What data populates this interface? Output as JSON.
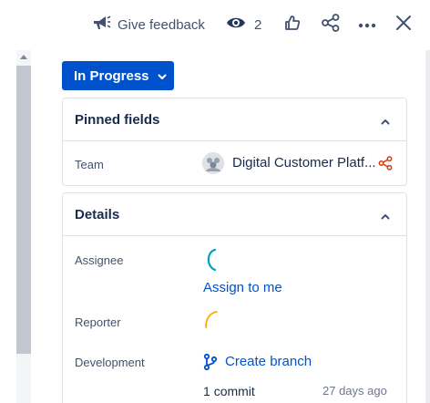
{
  "toolbar": {
    "feedback_label": "Give feedback",
    "watch_count": "2",
    "icons": [
      "megaphone-icon",
      "eye-icon",
      "thumbs-up-icon",
      "share-icon",
      "more-icon",
      "close-icon"
    ]
  },
  "status": {
    "label": "In Progress"
  },
  "pinned": {
    "title": "Pinned fields",
    "fields": [
      {
        "label": "Team",
        "value": "Digital Customer Platf..."
      }
    ]
  },
  "details": {
    "title": "Details",
    "assignee_label": "Assignee",
    "assign_link": "Assign to me",
    "reporter_label": "Reporter",
    "development_label": "Development",
    "create_branch": "Create branch",
    "commit_count": "1",
    "commit_word": "commit",
    "commit_age": "27 days ago"
  },
  "colors": {
    "brand": "#0052cc",
    "share_accent": "#de350b",
    "assignee_avatar": "#00a3bf",
    "reporter_avatar": "#ffab00"
  }
}
